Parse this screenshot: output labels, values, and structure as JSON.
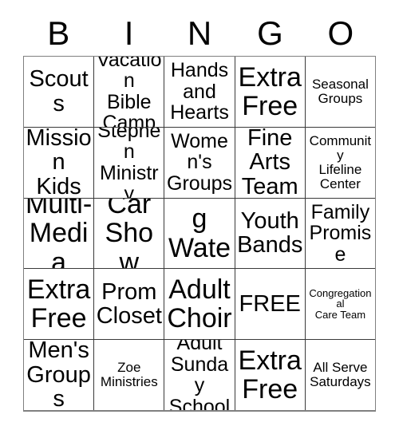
{
  "card": {
    "type": "bingo-card",
    "columns": 5,
    "rows": 5,
    "header_letters": [
      "B",
      "I",
      "N",
      "G",
      "O"
    ],
    "free_space_label": "FREE",
    "free_space_position": {
      "row": 4,
      "column": 4
    },
    "colors": {
      "background": "#ffffff",
      "text": "#000000",
      "grid_line": "#3a3a3a",
      "outer_border": "#808080"
    },
    "rows_data": [
      [
        {
          "text": "Scouts",
          "size": "lg"
        },
        {
          "text": "Vacation\nBible\nCamp",
          "size": "md"
        },
        {
          "text": "Hands\nand\nHearts",
          "size": "md"
        },
        {
          "text": "Extra\nFree",
          "size": "xl"
        },
        {
          "text": "Seasonal\nGroups",
          "size": "sm"
        }
      ],
      [
        {
          "text": "Mission\nKids",
          "size": "lg"
        },
        {
          "text": "Stephen\nMinistry",
          "size": "md"
        },
        {
          "text": "Women's\nGroups",
          "size": "md"
        },
        {
          "text": "Fine\nArts\nTeam",
          "size": "lg"
        },
        {
          "text": "Community\nLifeline\nCenter",
          "size": "sm"
        }
      ],
      [
        {
          "text": "Multi-\nMedia",
          "size": "xl"
        },
        {
          "text": "Car\nShow",
          "size": "xl"
        },
        {
          "text": "Living\nWater",
          "size": "xl"
        },
        {
          "text": "Youth\nBands",
          "size": "lg"
        },
        {
          "text": "Family\nPromise",
          "size": "md"
        }
      ],
      [
        {
          "text": "Extra\nFree",
          "size": "xl"
        },
        {
          "text": "Prom\nCloset",
          "size": "lg"
        },
        {
          "text": "Adult\nChoir",
          "size": "xl"
        },
        {
          "text": "FREE",
          "size": "lg"
        },
        {
          "text": "Congregational\nCare Team",
          "size": "xs"
        }
      ],
      [
        {
          "text": "Men's\nGroups",
          "size": "lg"
        },
        {
          "text": "Zoe\nMinistries",
          "size": "sm"
        },
        {
          "text": "Adult\nSunday\nSchool",
          "size": "md"
        },
        {
          "text": "Extra\nFree",
          "size": "xl"
        },
        {
          "text": "All Serve\nSaturdays",
          "size": "sm"
        }
      ]
    ]
  }
}
